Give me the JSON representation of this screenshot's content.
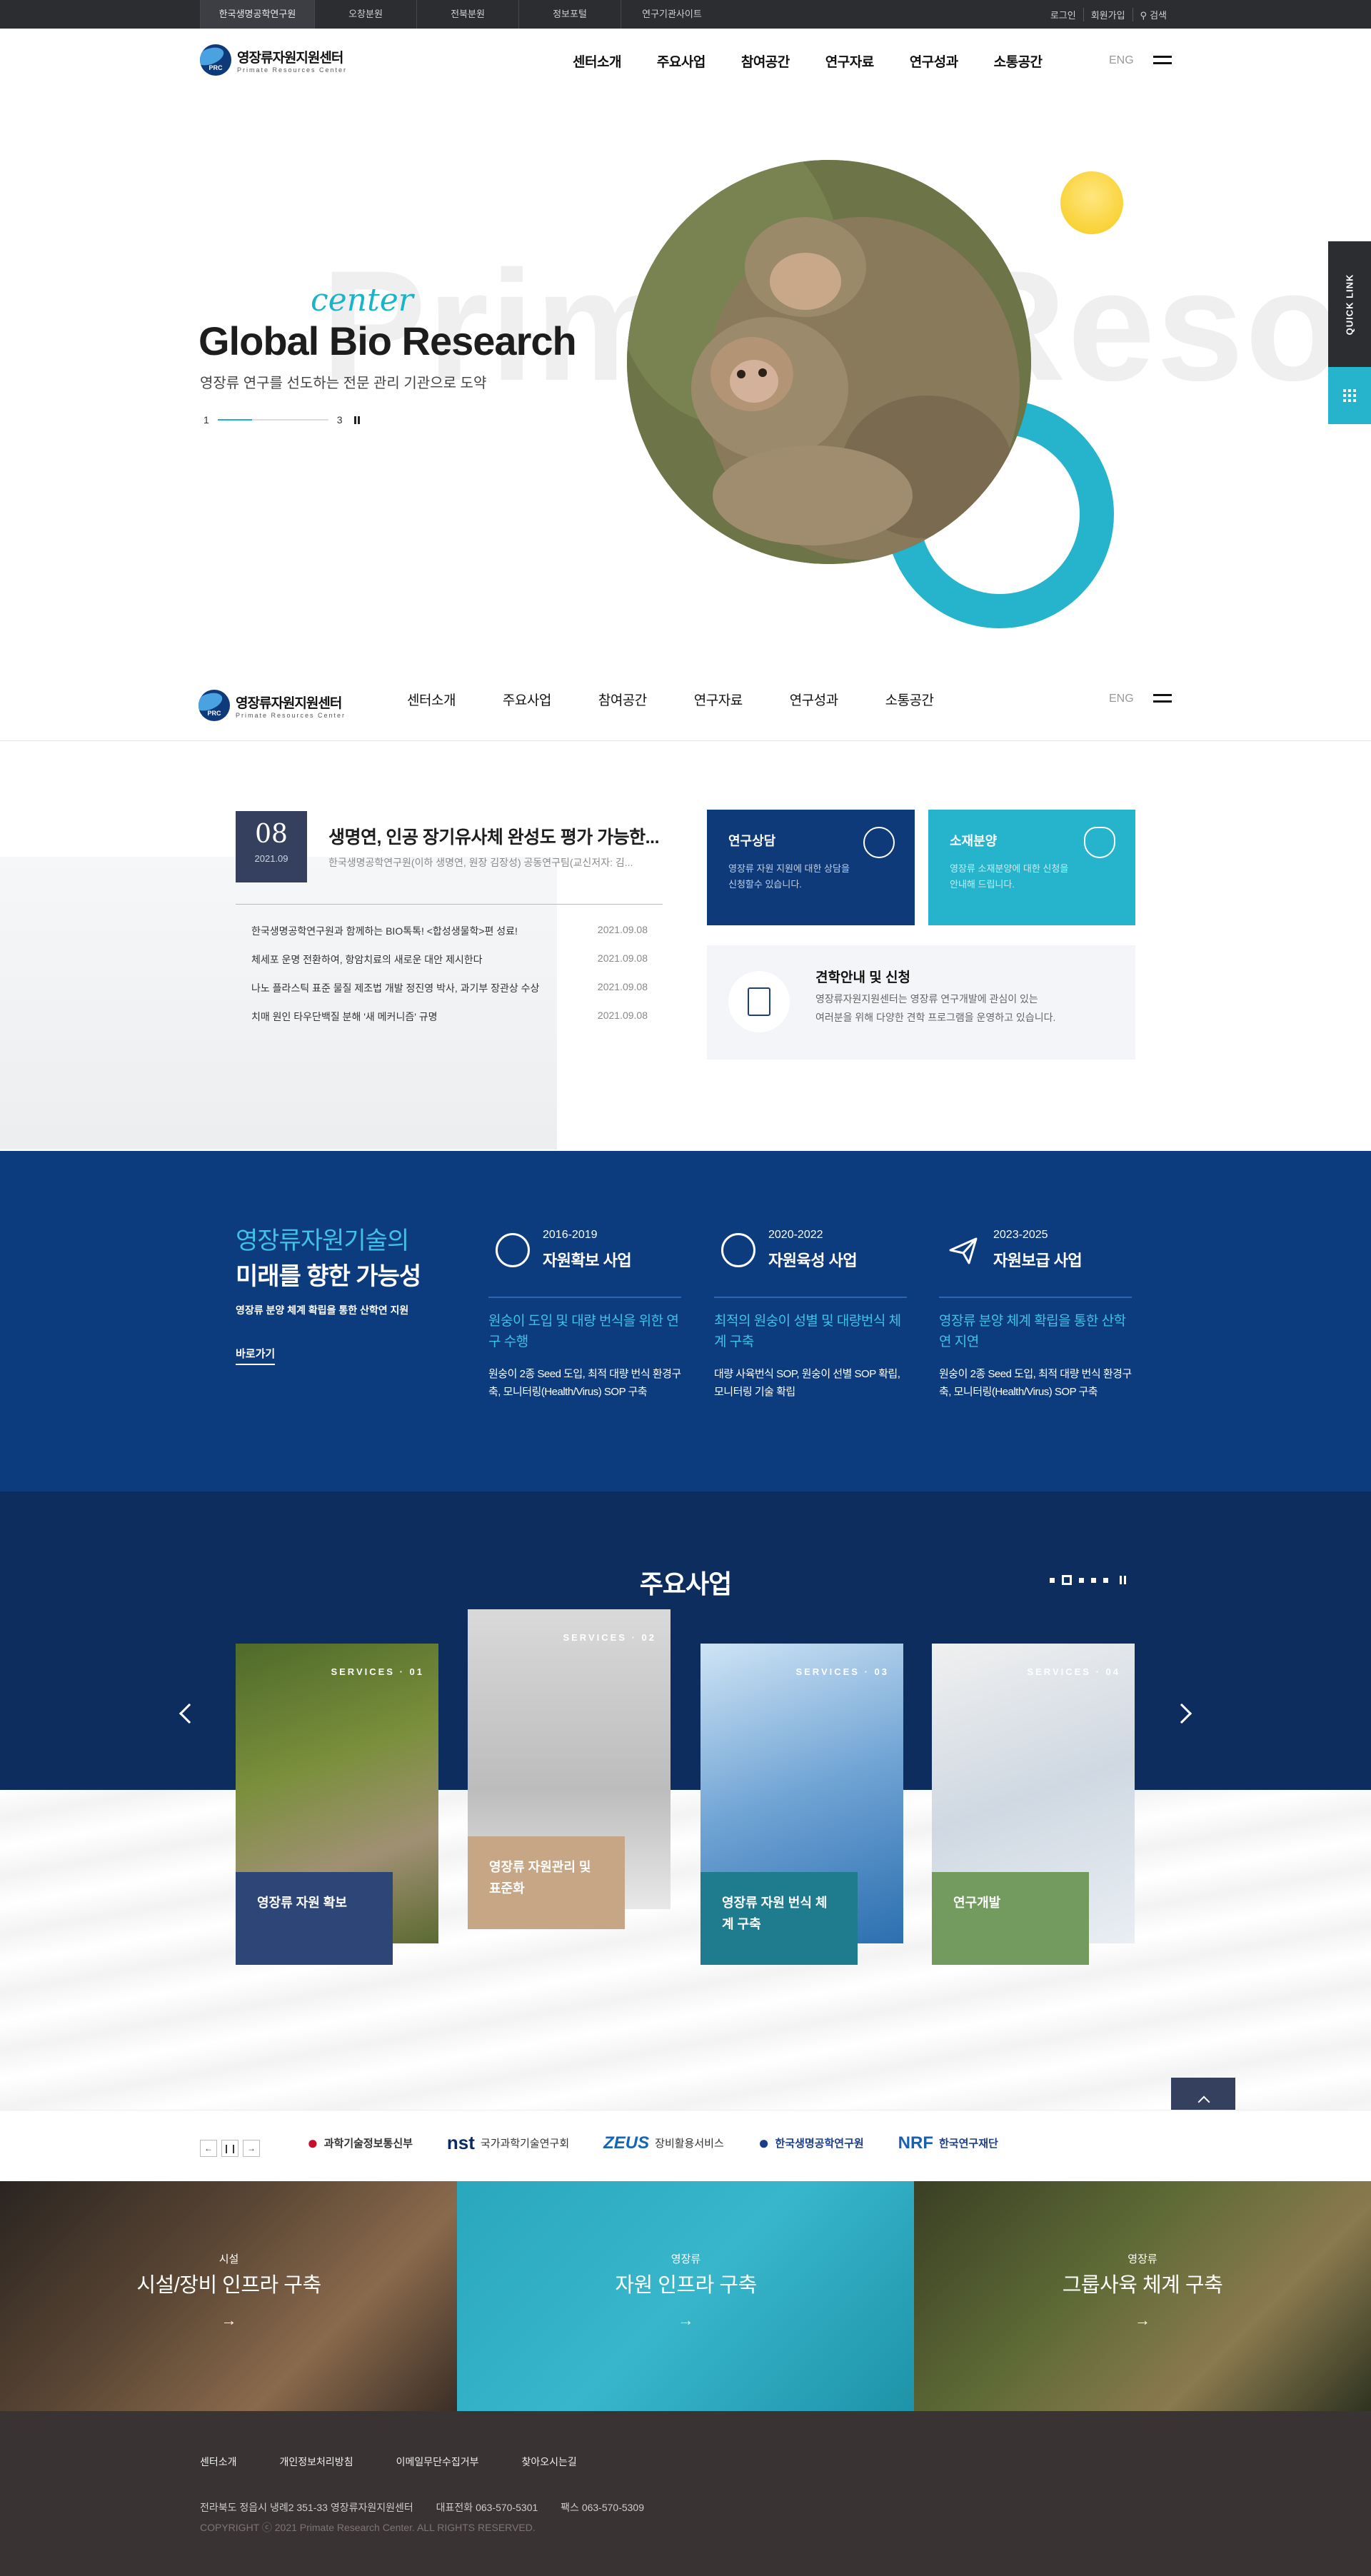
{
  "topbar": {
    "sites": [
      "한국생명공학연구원",
      "오창분원",
      "전북분원",
      "정보포털",
      "연구기관사이트"
    ],
    "util": [
      "로그인",
      "회원가입",
      "검색"
    ]
  },
  "header": {
    "logo_ko": "영장류자원지원센터",
    "logo_en": "Primate Resources Center",
    "logo_mark": "PRC",
    "nav": [
      "센터소개",
      "주요사업",
      "참여공간",
      "연구자료",
      "연구성과",
      "소통공간"
    ],
    "lang": "ENG"
  },
  "hero": {
    "bg_text": "Primate Reso",
    "script": "center",
    "title": "Global Bio Research",
    "subtitle": "영장류 연구를 선도하는 전문 관리 기관으로 도약",
    "pager_current": "1",
    "pager_total": "3",
    "progress": 0.31
  },
  "quick": {
    "label": "QUICK LINK"
  },
  "news": {
    "day": "08",
    "month": "2021.09",
    "title": "생명연, 인공 장기유사체 완성도 평가 가능한...",
    "desc": "한국생명공학연구원(이하 생명연, 원장 김장성) 공동연구팀(교신저자: 김...",
    "items": [
      {
        "title": "한국생명공학연구원과 함께하는 BIO톡톡! <합성생물학>편 성료!",
        "date": "2021.09.08"
      },
      {
        "title": "체세포 운명 전환하여, 항암치료의 새로운 대안 제시한다",
        "date": "2021.09.08"
      },
      {
        "title": "나노 플라스틱 표준 물질 제조법 개발 정진영 박사, 과기부 장관상 수상",
        "date": "2021.09.08"
      },
      {
        "title": "치매 원인 타우단백질 분해 '새 메커니즘' 규명",
        "date": "2021.09.08"
      }
    ]
  },
  "cards": {
    "consult": {
      "title": "연구상담",
      "desc": "영장류 자원 지원에 대한 상담을 신청할수 있습니다."
    },
    "supply": {
      "title": "소재분양",
      "desc": "영장류 소재분양에 대한 신청을 안내해 드립니다."
    },
    "tour": {
      "title": "견학안내 및 신청",
      "desc1": "영장류자원지원센터는 영장류 연구개발에 관심이 있는",
      "desc2": "여러분을 위해 다양한 견학 프로그램을 운영하고 있습니다."
    }
  },
  "tech": {
    "h1": "영장류자원기술의",
    "h2": "미래를 향한 가능성",
    "h3": "영장류 분양 체계 확립을 통한 산학연 지원",
    "more": "바로가기",
    "phases": [
      {
        "years": "2016-2019",
        "name": "자원확보 사업",
        "headline": "원숭이 도입 및 대량 번식을 위한 연구 수행",
        "body": "원숭이 2종 Seed 도입, 최적 대량 번식 환경구축, 모니터링(Health/Virus) SOP 구축"
      },
      {
        "years": "2020-2022",
        "name": "자원육성 사업",
        "headline": "최적의 원숭이 성별 및 대량번식 체계 구축",
        "body": "대량 사육번식 SOP, 원숭이 선별 SOP 확립, 모니터링 기술 확립"
      },
      {
        "years": "2023-2025",
        "name": "자원보급 사업",
        "headline": "영장류 분양 체계 확립을 통한 산학연 지연",
        "body": "원숭이 2종 Seed 도입, 최적 대량 번식 환경구축, 모니터링(Health/Virus) SOP 구축"
      }
    ]
  },
  "services": {
    "title": "주요사업",
    "items": [
      {
        "label": "SERVICES · 01",
        "name": "영장류 자원 확보",
        "color": "#2e4677"
      },
      {
        "label": "SERVICES · 02",
        "name": "영장류 자원관리 및 표준화",
        "color": "#c6a684"
      },
      {
        "label": "SERVICES · 03",
        "name": "영장류 자원 번식 체계 구축",
        "color": "#1f7c8e"
      },
      {
        "label": "SERVICES · 04",
        "name": "연구개발",
        "color": "#739b5f"
      }
    ],
    "top": "TOP"
  },
  "partners": [
    {
      "name": "과학기술정보통신부",
      "mark": "●"
    },
    {
      "name": "국가과학기술연구회",
      "mark": "nst"
    },
    {
      "name": "장비활용서비스",
      "mark": "ZEUS"
    },
    {
      "name": "한국생명공학연구원",
      "mark": "●"
    },
    {
      "name": "한국연구재단",
      "mark": "NRF"
    }
  ],
  "infra": [
    {
      "small": "시설",
      "large": "시설/장비 인프라 구축"
    },
    {
      "small": "영장류",
      "large": "자원 인프라 구축"
    },
    {
      "small": "영장류",
      "large": "그룹사육 체계 구축"
    }
  ],
  "footer": {
    "links": [
      "센터소개",
      "개인정보처리방침",
      "이메일무단수집거부",
      "찾아오시는길"
    ],
    "address": "전라북도 정읍시 냉례2 351-33 영장류자원지원센터",
    "tel": "대표전화 063-570-5301",
    "fax": "팩스 063-570-5309",
    "copyright": "COPYRIGHT ⓒ 2021 Primate Research Center. ALL RIGHTS RESERVED."
  }
}
